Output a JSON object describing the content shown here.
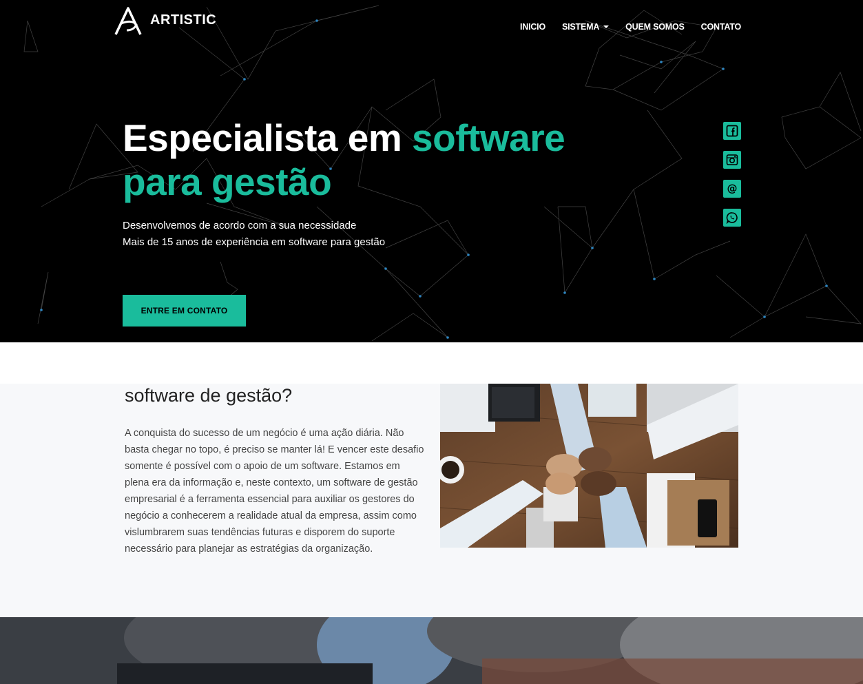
{
  "brand": {
    "name": "ARTISTIC"
  },
  "nav": {
    "items": [
      {
        "label": "INICIO"
      },
      {
        "label": "SISTEMA"
      },
      {
        "label": "QUEM SOMOS"
      },
      {
        "label": "CONTATO"
      }
    ]
  },
  "hero": {
    "title_part1": "Especialista em ",
    "title_accent1": "software",
    "title_accent2": "para gestão",
    "subtitle_line1": "Desenvolvemos de acordo com a sua necessidade",
    "subtitle_line2": "Mais de 15 anos de experiência em software para gestão",
    "cta_label": "ENTRE EM CONTATO"
  },
  "social": [
    {
      "icon": "facebook-icon"
    },
    {
      "icon": "instagram-icon"
    },
    {
      "icon": "email-at-icon"
    },
    {
      "icon": "whatsapp-icon"
    }
  ],
  "about": {
    "title": "software de gestão?",
    "text": "A conquista do sucesso de um negócio é uma ação diária. Não basta chegar no topo, é preciso se manter lá! E vencer este desafio somente é possível com o apoio de um software. Estamos em plena era da informação e, neste contexto, um software de gestão empresarial é a ferramenta essencial para auxiliar os gestores do negócio a conhecerem a realidade atual da empresa, assim como vislumbrarem suas tendências futuras e disporem do suporte necessário para planejar as estratégias da organização."
  },
  "colors": {
    "accent": "#1abc9c",
    "hero_bg": "#000000",
    "about_bg": "#f7f8fa"
  }
}
